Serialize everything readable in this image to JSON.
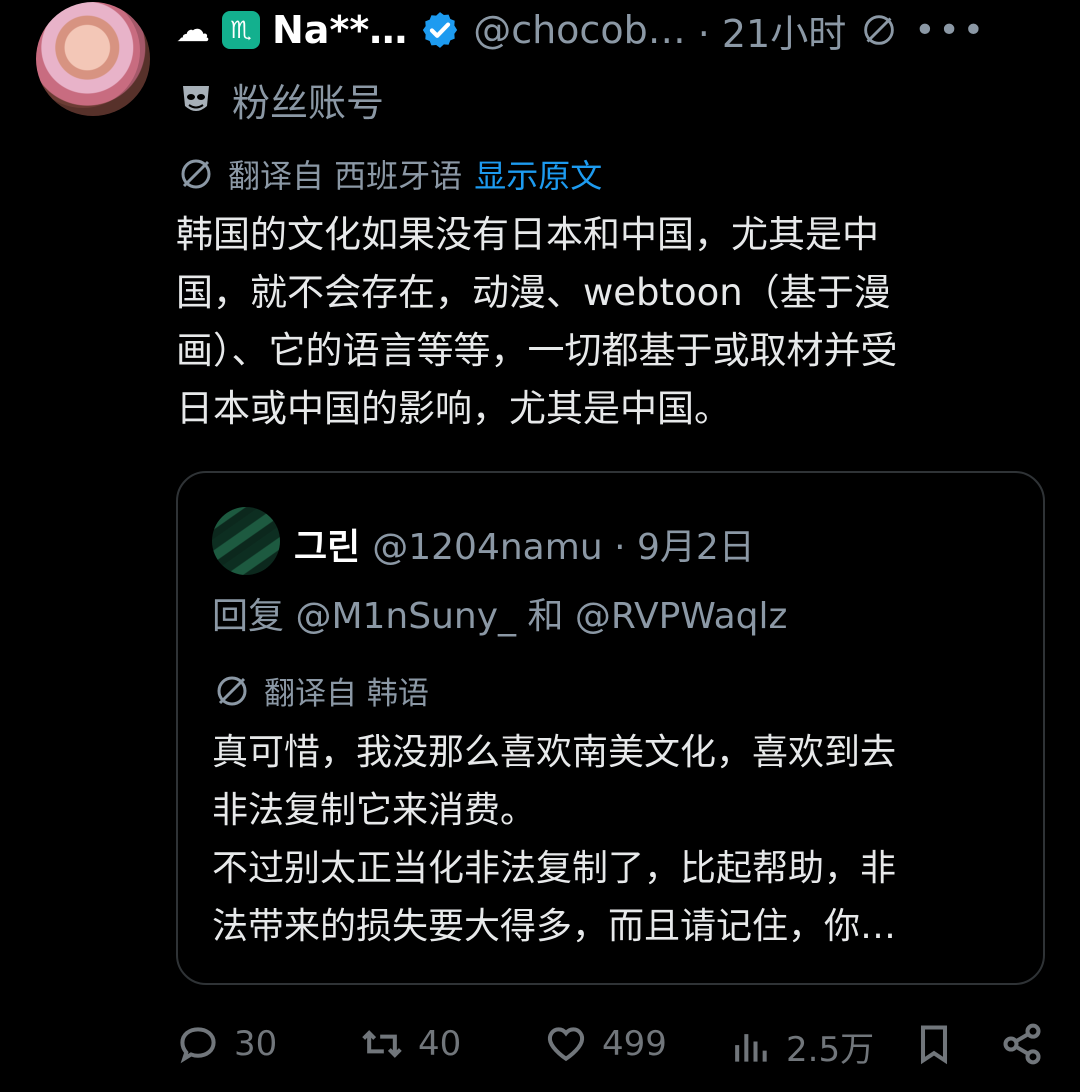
{
  "author": {
    "name": "Na**…",
    "handle": "@chocob…",
    "time": "21小时",
    "fan_label": "粉丝账号",
    "icon_names": [
      "cloud-icon",
      "scorpio-icon",
      "verified-badge-icon",
      "translate-icon",
      "more-icon",
      "mask-icon"
    ]
  },
  "translation": {
    "from_label": "翻译自 西班牙语",
    "show_original": "显示原文"
  },
  "body": "韩国的文化如果没有日本和中国，尤其是中\n国，就不会存在，动漫、webtoon（基于漫\n画）、它的语言等等，一切都基于或取材并受\n日本或中国的影响，尤其是中国。",
  "quote": {
    "name": "그린",
    "handle_date": "@1204namu · 9月2日",
    "reply_to": "回复 @M1nSuny_ 和 @RVPWaqlz",
    "translated_from": "翻译自 韩语",
    "body": "真可惜，我没那么喜欢南美文化，喜欢到去\n非法复制它来消费。\n不过别太正当化非法复制了，比起帮助，非\n法带来的损失要大得多，而且请记住，你…"
  },
  "actions": {
    "replies": "30",
    "retweets": "40",
    "likes": "499",
    "views": "2.5万"
  },
  "colors": {
    "background": "#000000",
    "text": "#e7e9ea",
    "muted": "#8b98a5",
    "link": "#1d9bf0",
    "border": "#2f3336",
    "verified": "#1d9bf0",
    "zodiac_badge": "#13b08e"
  }
}
